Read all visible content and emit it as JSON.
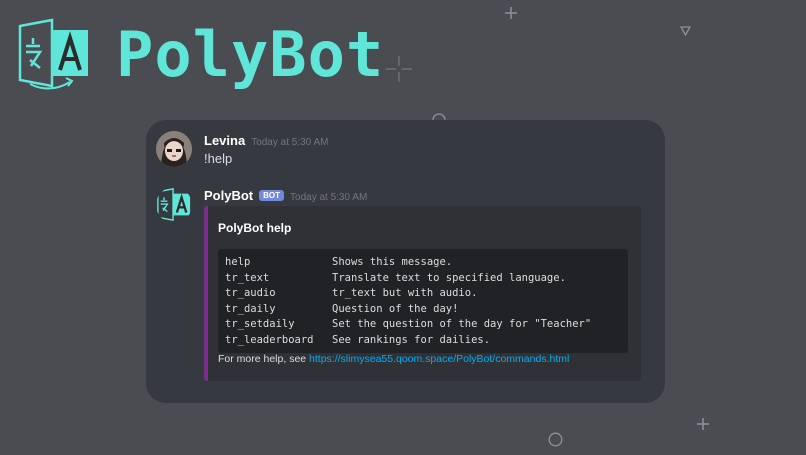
{
  "header": {
    "logo_icon": "translate-icon",
    "brand_title": "PolyBot",
    "colors": {
      "brand": "#5fe6d8",
      "background": "#4a4c52"
    }
  },
  "messages": [
    {
      "username": "Levina",
      "timestamp": "Today at 5:30 AM",
      "text": "!help",
      "avatar": "user-avatar"
    },
    {
      "username": "PolyBot",
      "badge": "BOT",
      "timestamp": "Today at 5:30 AM",
      "avatar": "translate-icon",
      "embed": {
        "title": "PolyBot help",
        "accent_color": "#7b2e8e",
        "commands": [
          {
            "name": "help",
            "desc": "Shows this message."
          },
          {
            "name": "tr_text",
            "desc": "Translate text to specified language."
          },
          {
            "name": "tr_audio",
            "desc": "tr_text but with audio."
          },
          {
            "name": "tr_daily",
            "desc": "Question of the day!"
          },
          {
            "name": "tr_setdaily",
            "desc": "Set the question of the day for \"Teacher\""
          },
          {
            "name": "tr_leaderboard",
            "desc": "See rankings for dailies."
          }
        ],
        "footer_prefix": "For more help, see ",
        "footer_link": "https://slimysea55.qoom.space/PolyBot/commands.html"
      }
    }
  ]
}
